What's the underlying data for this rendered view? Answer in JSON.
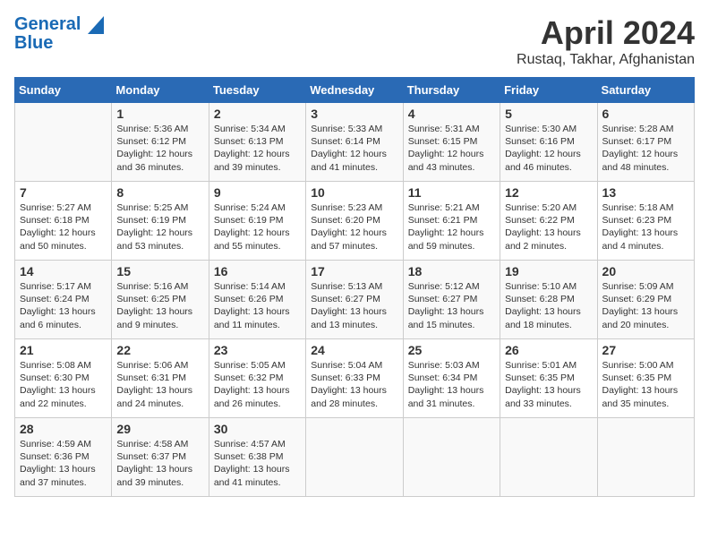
{
  "logo": {
    "line1": "General",
    "line2": "Blue"
  },
  "title": "April 2024",
  "location": "Rustaq, Takhar, Afghanistan",
  "days_of_week": [
    "Sunday",
    "Monday",
    "Tuesday",
    "Wednesday",
    "Thursday",
    "Friday",
    "Saturday"
  ],
  "weeks": [
    [
      {
        "day": "",
        "info": ""
      },
      {
        "day": "1",
        "info": "Sunrise: 5:36 AM\nSunset: 6:12 PM\nDaylight: 12 hours\nand 36 minutes."
      },
      {
        "day": "2",
        "info": "Sunrise: 5:34 AM\nSunset: 6:13 PM\nDaylight: 12 hours\nand 39 minutes."
      },
      {
        "day": "3",
        "info": "Sunrise: 5:33 AM\nSunset: 6:14 PM\nDaylight: 12 hours\nand 41 minutes."
      },
      {
        "day": "4",
        "info": "Sunrise: 5:31 AM\nSunset: 6:15 PM\nDaylight: 12 hours\nand 43 minutes."
      },
      {
        "day": "5",
        "info": "Sunrise: 5:30 AM\nSunset: 6:16 PM\nDaylight: 12 hours\nand 46 minutes."
      },
      {
        "day": "6",
        "info": "Sunrise: 5:28 AM\nSunset: 6:17 PM\nDaylight: 12 hours\nand 48 minutes."
      }
    ],
    [
      {
        "day": "7",
        "info": "Sunrise: 5:27 AM\nSunset: 6:18 PM\nDaylight: 12 hours\nand 50 minutes."
      },
      {
        "day": "8",
        "info": "Sunrise: 5:25 AM\nSunset: 6:19 PM\nDaylight: 12 hours\nand 53 minutes."
      },
      {
        "day": "9",
        "info": "Sunrise: 5:24 AM\nSunset: 6:19 PM\nDaylight: 12 hours\nand 55 minutes."
      },
      {
        "day": "10",
        "info": "Sunrise: 5:23 AM\nSunset: 6:20 PM\nDaylight: 12 hours\nand 57 minutes."
      },
      {
        "day": "11",
        "info": "Sunrise: 5:21 AM\nSunset: 6:21 PM\nDaylight: 12 hours\nand 59 minutes."
      },
      {
        "day": "12",
        "info": "Sunrise: 5:20 AM\nSunset: 6:22 PM\nDaylight: 13 hours\nand 2 minutes."
      },
      {
        "day": "13",
        "info": "Sunrise: 5:18 AM\nSunset: 6:23 PM\nDaylight: 13 hours\nand 4 minutes."
      }
    ],
    [
      {
        "day": "14",
        "info": "Sunrise: 5:17 AM\nSunset: 6:24 PM\nDaylight: 13 hours\nand 6 minutes."
      },
      {
        "day": "15",
        "info": "Sunrise: 5:16 AM\nSunset: 6:25 PM\nDaylight: 13 hours\nand 9 minutes."
      },
      {
        "day": "16",
        "info": "Sunrise: 5:14 AM\nSunset: 6:26 PM\nDaylight: 13 hours\nand 11 minutes."
      },
      {
        "day": "17",
        "info": "Sunrise: 5:13 AM\nSunset: 6:27 PM\nDaylight: 13 hours\nand 13 minutes."
      },
      {
        "day": "18",
        "info": "Sunrise: 5:12 AM\nSunset: 6:27 PM\nDaylight: 13 hours\nand 15 minutes."
      },
      {
        "day": "19",
        "info": "Sunrise: 5:10 AM\nSunset: 6:28 PM\nDaylight: 13 hours\nand 18 minutes."
      },
      {
        "day": "20",
        "info": "Sunrise: 5:09 AM\nSunset: 6:29 PM\nDaylight: 13 hours\nand 20 minutes."
      }
    ],
    [
      {
        "day": "21",
        "info": "Sunrise: 5:08 AM\nSunset: 6:30 PM\nDaylight: 13 hours\nand 22 minutes."
      },
      {
        "day": "22",
        "info": "Sunrise: 5:06 AM\nSunset: 6:31 PM\nDaylight: 13 hours\nand 24 minutes."
      },
      {
        "day": "23",
        "info": "Sunrise: 5:05 AM\nSunset: 6:32 PM\nDaylight: 13 hours\nand 26 minutes."
      },
      {
        "day": "24",
        "info": "Sunrise: 5:04 AM\nSunset: 6:33 PM\nDaylight: 13 hours\nand 28 minutes."
      },
      {
        "day": "25",
        "info": "Sunrise: 5:03 AM\nSunset: 6:34 PM\nDaylight: 13 hours\nand 31 minutes."
      },
      {
        "day": "26",
        "info": "Sunrise: 5:01 AM\nSunset: 6:35 PM\nDaylight: 13 hours\nand 33 minutes."
      },
      {
        "day": "27",
        "info": "Sunrise: 5:00 AM\nSunset: 6:35 PM\nDaylight: 13 hours\nand 35 minutes."
      }
    ],
    [
      {
        "day": "28",
        "info": "Sunrise: 4:59 AM\nSunset: 6:36 PM\nDaylight: 13 hours\nand 37 minutes."
      },
      {
        "day": "29",
        "info": "Sunrise: 4:58 AM\nSunset: 6:37 PM\nDaylight: 13 hours\nand 39 minutes."
      },
      {
        "day": "30",
        "info": "Sunrise: 4:57 AM\nSunset: 6:38 PM\nDaylight: 13 hours\nand 41 minutes."
      },
      {
        "day": "",
        "info": ""
      },
      {
        "day": "",
        "info": ""
      },
      {
        "day": "",
        "info": ""
      },
      {
        "day": "",
        "info": ""
      }
    ]
  ]
}
